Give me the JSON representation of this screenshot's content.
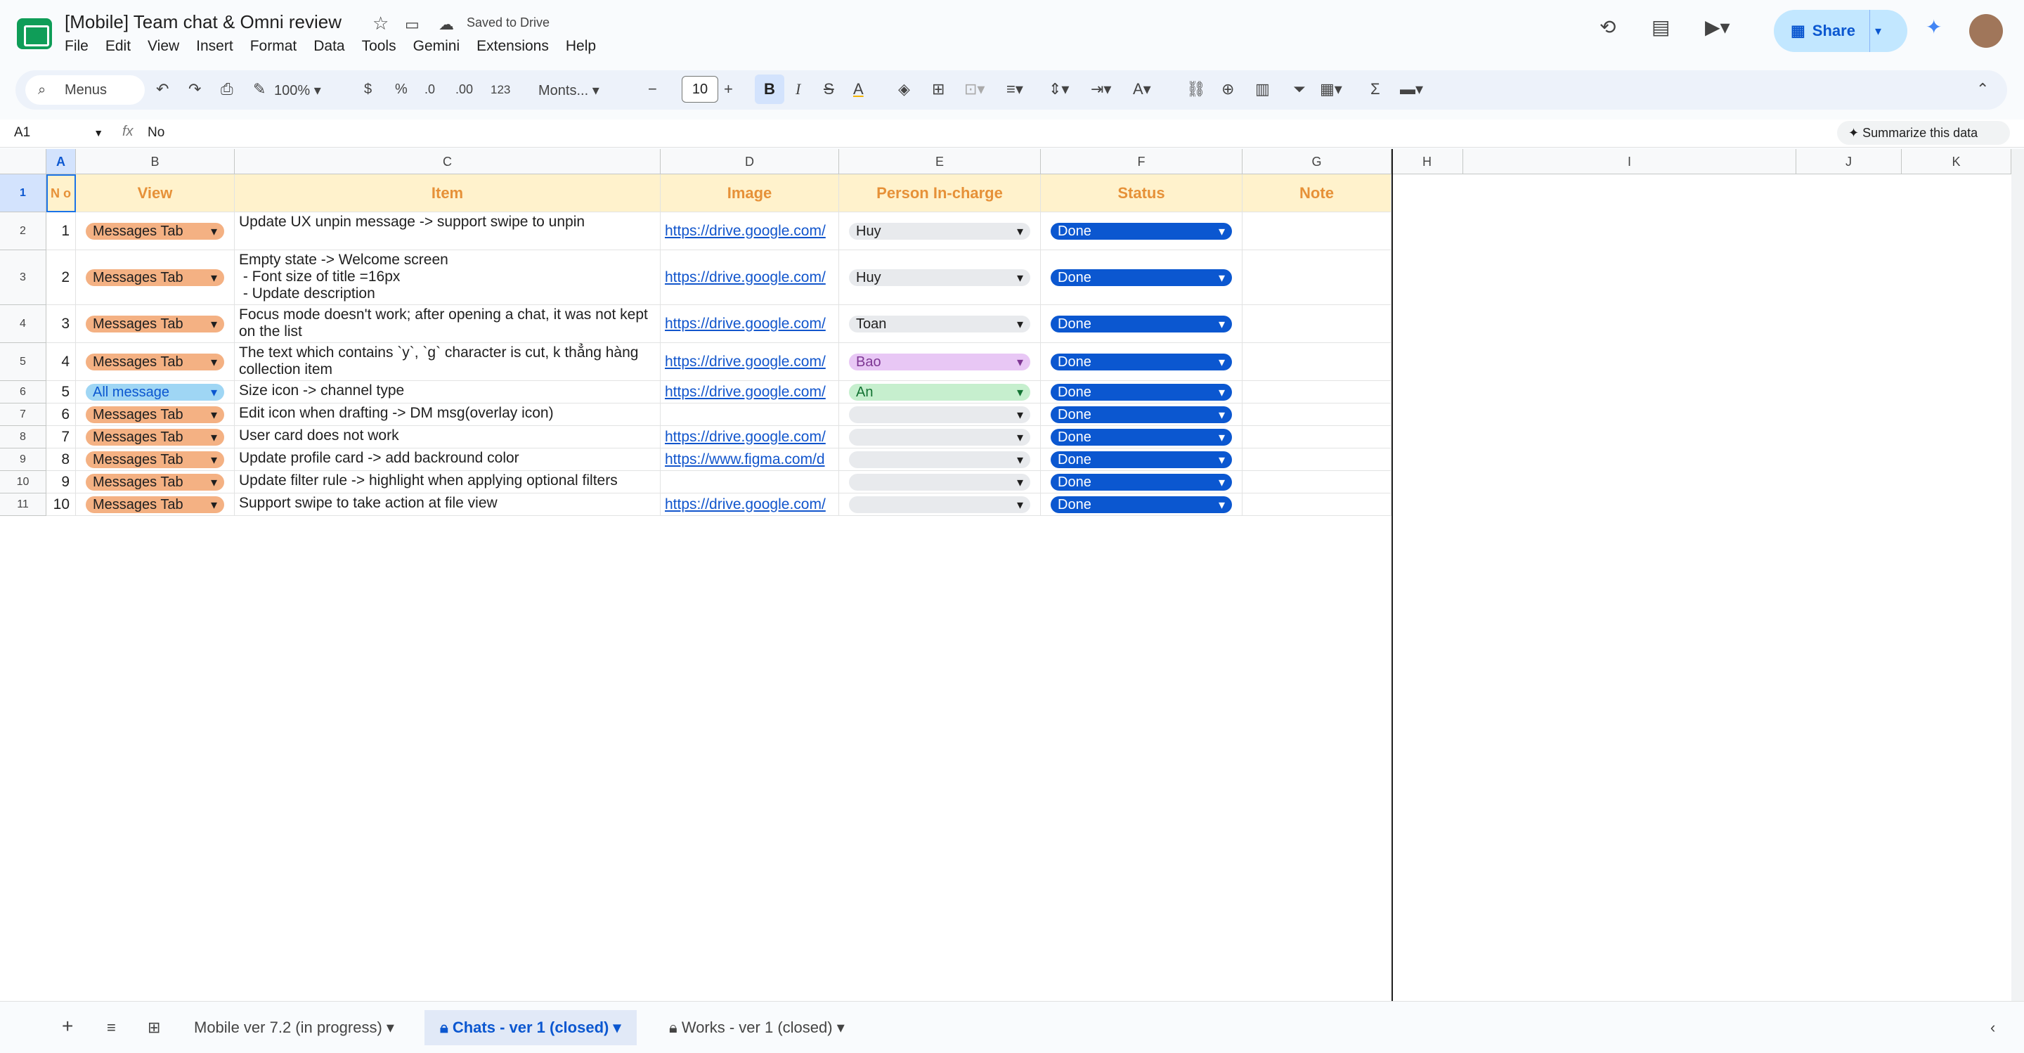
{
  "app": {
    "title": "[Mobile] Team chat & Omni review",
    "saved_status": "Saved to Drive"
  },
  "menu": [
    "File",
    "Edit",
    "View",
    "Insert",
    "Format",
    "Data",
    "Tools",
    "Gemini",
    "Extensions",
    "Help"
  ],
  "header_actions": {
    "share_label": "Share"
  },
  "toolbar": {
    "menus_label": "Menus",
    "zoom": "100%",
    "currency": "$",
    "percent": "%",
    "dec_minus": ".0",
    "dec_plus": ".00",
    "num_format": "123",
    "font": "Monts...",
    "font_size": "10",
    "bold": "B",
    "italic": "I"
  },
  "formula_bar": {
    "cell_ref": "A1",
    "fx": "fx",
    "value": "No",
    "summarize_label": "Summarize this data"
  },
  "columns": [
    "A",
    "B",
    "C",
    "D",
    "E",
    "F",
    "G",
    "H",
    "I",
    "J",
    "K"
  ],
  "headers": {
    "no": "N o",
    "view": "View",
    "item": "Item",
    "image": "Image",
    "person": "Person In-charge",
    "status": "Status",
    "note": "Note"
  },
  "rows": [
    {
      "row": "2",
      "no": "1",
      "view": "Messages Tab",
      "view_type": "msg",
      "item": "Update UX unpin message -> support swipe to unpin",
      "image": "https://drive.google.com/",
      "person": "Huy",
      "person_type": "huy",
      "status": "Done",
      "status_type": "done"
    },
    {
      "row": "3",
      "no": "2",
      "view": "Messages Tab",
      "view_type": "msg",
      "item": "Empty state -> Welcome screen\n - Font size of title =16px\n - Update description",
      "image": "https://drive.google.com/",
      "person": "Huy",
      "person_type": "huy",
      "status": "Done",
      "status_type": "done"
    },
    {
      "row": "4",
      "no": "3",
      "view": "Messages Tab",
      "view_type": "msg",
      "item": "Focus mode doesn't work; after opening a chat, it was not kept on the list",
      "image": "https://drive.google.com/",
      "person": "Toan",
      "person_type": "huy",
      "status": "Done",
      "status_type": "done"
    },
    {
      "row": "5",
      "no": "4",
      "view": "Messages Tab",
      "view_type": "msg",
      "item": "The text which contains `y`, `g` character is cut, k thẳng hàng collection item",
      "image": "https://drive.google.com/",
      "person": "Bao",
      "person_type": "bao",
      "status": "Done",
      "status_type": "done"
    },
    {
      "row": "6",
      "no": "5",
      "view": "All message",
      "view_type": "all",
      "item": "Size icon -> channel type",
      "image": "https://drive.google.com/",
      "person": "An",
      "person_type": "an",
      "status": "Done",
      "status_type": "done"
    },
    {
      "row": "7",
      "no": "6",
      "view": "Messages Tab",
      "view_type": "msg",
      "item": "Edit icon when drafting -> DM msg(overlay icon)",
      "image": "",
      "person": "",
      "person_type": "empty",
      "status": "Done",
      "status_type": "done"
    },
    {
      "row": "8",
      "no": "7",
      "view": "Messages Tab",
      "view_type": "msg",
      "item": "User card does not work",
      "image": "https://drive.google.com/",
      "person": "",
      "person_type": "empty",
      "status": "Done",
      "status_type": "done"
    },
    {
      "row": "9",
      "no": "8",
      "view": "Messages Tab",
      "view_type": "msg",
      "item": "Update profile card -> add backround color",
      "image": "https://www.figma.com/d",
      "person": "",
      "person_type": "empty",
      "status": "Done",
      "status_type": "done"
    },
    {
      "row": "10",
      "no": "9",
      "view": "Messages Tab",
      "view_type": "msg",
      "item": "Update filter rule -> highlight when applying optional filters",
      "image": "",
      "person": "",
      "person_type": "empty",
      "status": "Done",
      "status_type": "done"
    },
    {
      "row": "11",
      "no": "10",
      "view": "Messages Tab",
      "view_type": "msg",
      "item": "Support swipe to take action at file view",
      "image": "https://drive.google.com/",
      "person": "",
      "person_type": "empty",
      "status": "Done",
      "status_type": "done"
    }
  ],
  "sheet_tabs": [
    {
      "label": "Mobile ver 7.2 (in progress)",
      "active": false
    },
    {
      "label": "Chats - ver 1 (closed)",
      "active": true
    },
    {
      "label": "Works - ver 1 (closed)",
      "active": false
    }
  ]
}
